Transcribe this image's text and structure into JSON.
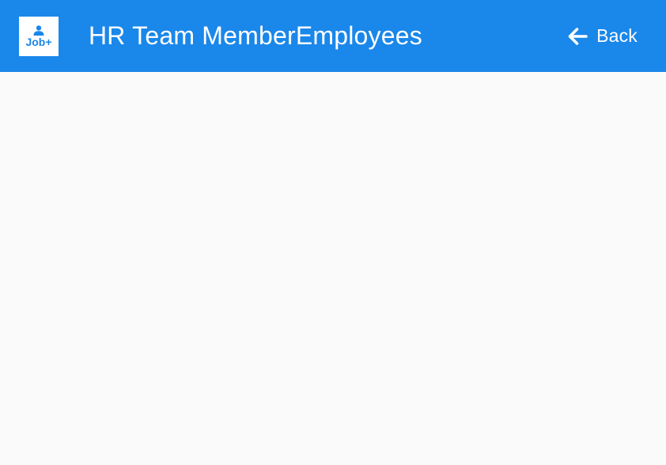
{
  "colors": {
    "app_bar": "#1a87ea",
    "background": "#fafafa",
    "logo_background": "#ffffff",
    "logo_accent": "#1a87ea",
    "on_primary": "#ffffff"
  },
  "header": {
    "logo": {
      "text": "Job+",
      "icon": "person-icon"
    },
    "title": "HR Team MemberEmployees",
    "back": {
      "label": "Back",
      "icon": "arrow-left-icon"
    }
  }
}
